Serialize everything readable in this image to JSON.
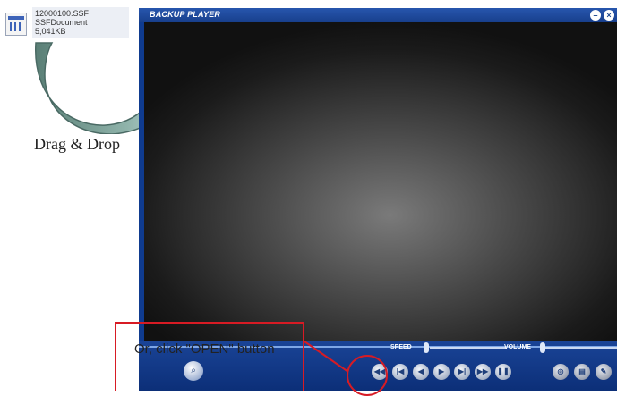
{
  "file": {
    "name": "12000100.SSF",
    "type": "SSFDocument",
    "size": "5,041KB"
  },
  "caption": "Drag & Drop",
  "player": {
    "title": "BACKUP PLAYER",
    "speed_label": "SPEED",
    "volume_label": "VOLUME"
  },
  "note": "Or, click \"OPEN\" button",
  "colors": {
    "accent": "#0f3b8f",
    "highlight": "#d71b24"
  }
}
